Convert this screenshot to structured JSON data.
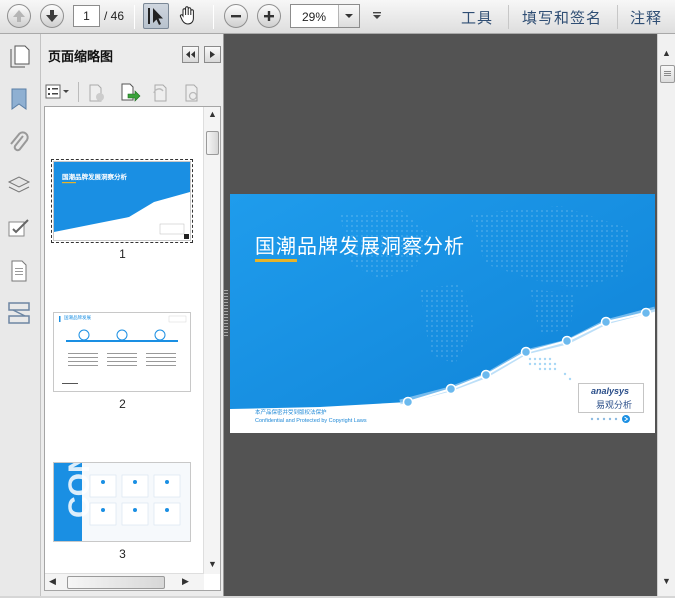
{
  "toolbar": {
    "page_current": "1",
    "page_total": "/ 46",
    "zoom_value": "29%",
    "tools_label": "工具",
    "sign_label": "填写和签名",
    "comment_label": "注释"
  },
  "panel": {
    "title": "页面缩略图",
    "thumbnails": [
      {
        "label": "1",
        "title": "国潮品牌发展洞察分析"
      },
      {
        "label": "2",
        "title": "国潮品牌发展"
      },
      {
        "label": "3"
      }
    ]
  },
  "slide": {
    "title": "国潮品牌发展洞察分析",
    "footer_line1": "本产品保密并受到版权法保护",
    "footer_line2": "Confidential and Protected by Copyright Laws",
    "logo_en": "analysys",
    "logo_cn": "易观分析"
  },
  "colors": {
    "brand_blue": "#1a8fe3",
    "accent_gold": "#e6b32a",
    "doc_background": "#535353"
  },
  "icons": {
    "rail": [
      "bookmark-icon",
      "attachment-icon",
      "layers-icon",
      "signature-icon",
      "page-icon",
      "compare-icon"
    ]
  }
}
